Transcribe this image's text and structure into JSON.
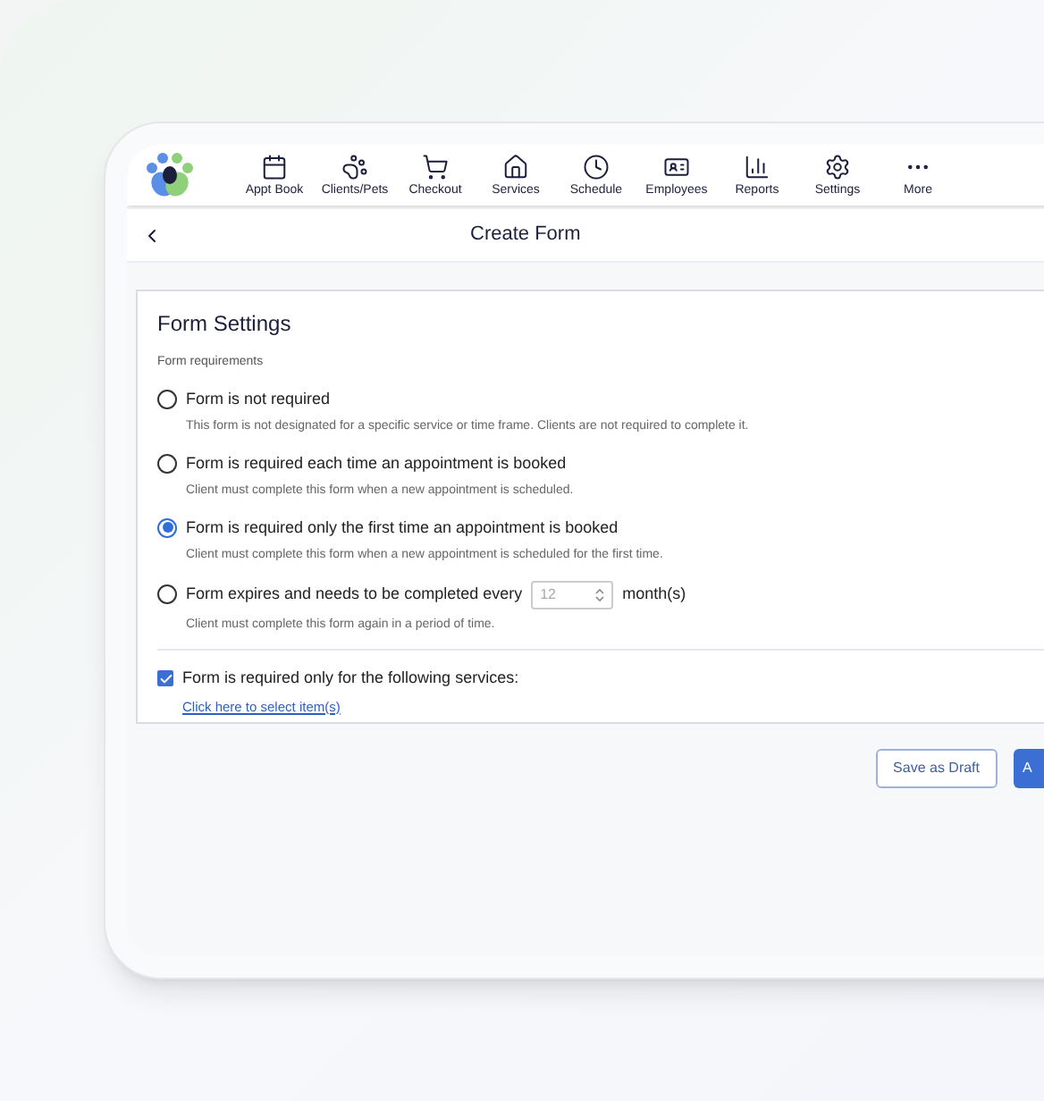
{
  "nav": {
    "items": [
      {
        "label": "Appt Book"
      },
      {
        "label": "Clients/Pets"
      },
      {
        "label": "Checkout"
      },
      {
        "label": "Services"
      },
      {
        "label": "Schedule"
      },
      {
        "label": "Employees"
      },
      {
        "label": "Reports"
      },
      {
        "label": "Settings"
      },
      {
        "label": "More"
      }
    ]
  },
  "header": {
    "title": "Create Form"
  },
  "card": {
    "title": "Form Settings",
    "subtitle": "Form requirements",
    "options": [
      {
        "kind": "plain",
        "label": "Form is not required",
        "description": "This form is not designated for a specific service or time frame. Clients are not required to complete it.",
        "selected": false
      },
      {
        "kind": "plain",
        "label": "Form is required each time an appointment is booked",
        "description": "Client must complete this form when a new appointment is scheduled.",
        "selected": false
      },
      {
        "kind": "plain",
        "label": "Form is required only the first time an appointment is booked",
        "description": "Client must complete this form when a new appointment is scheduled for the first time.",
        "selected": true
      },
      {
        "kind": "interval",
        "label": "Form expires and needs to be completed every",
        "value": "12",
        "unit": "month(s)",
        "description": "Client must complete this form again in a period of time.",
        "selected": false
      }
    ],
    "services": {
      "label": "Form is required only for the following services:",
      "checked": true,
      "link": "Click here to select item(s)"
    }
  },
  "buttons": [
    {
      "kind": "secondary",
      "label": "Save as Draft"
    },
    {
      "kind": "primary",
      "label": "A"
    }
  ]
}
